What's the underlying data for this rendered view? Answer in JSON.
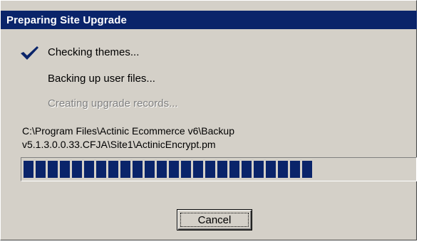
{
  "dialog": {
    "title": "Preparing Site Upgrade"
  },
  "steps": [
    {
      "label": "Checking themes...",
      "state": "done"
    },
    {
      "label": "Backing up user files...",
      "state": "active"
    },
    {
      "label": "Creating upgrade records...",
      "state": "disabled"
    }
  ],
  "current_path": {
    "line1": "C:\\Program Files\\Actinic Ecommerce v6\\Backup",
    "line2": "v5.1.3.0.0.33.CFJA\\Site1\\ActinicEncrypt.pm"
  },
  "progress": {
    "fraction": 0.74,
    "color": "#0a246a"
  },
  "buttons": {
    "cancel_label": "Cancel"
  },
  "icons": {
    "done_step": "checkmark-icon"
  },
  "colors": {
    "face": "#d4d0c8",
    "titlebar": "#0a246a",
    "check": "#0a246a"
  }
}
